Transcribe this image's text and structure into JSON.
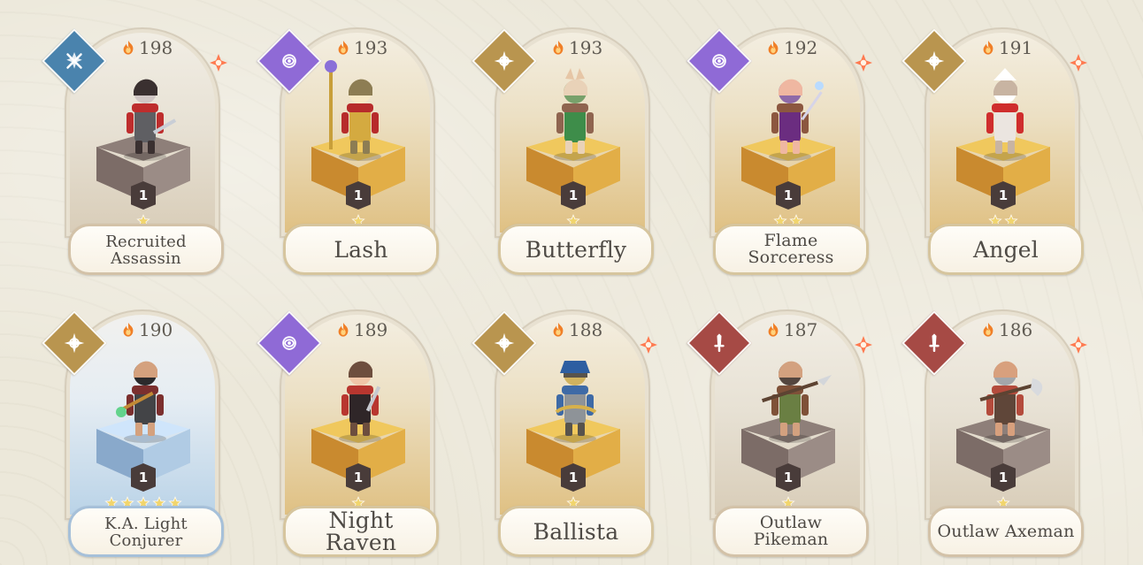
{
  "colors": {
    "background": "#ece8da",
    "text": "#4e4a45",
    "power_text": "#5f5a52",
    "common_banner": "#d3c2a8",
    "rare_banner": "#d6c59e",
    "epic_banner": "#a6c0d9",
    "common_pedestal": "#8e7f79",
    "rare_pedestal": "#f0c85d",
    "epic_pedestal": "#cfe5fb",
    "class_blue": "#4a83ad",
    "class_purple": "#8f6ad6",
    "class_gold": "#b9954f",
    "class_red": "#a64a45",
    "gem": "#ff7a50",
    "star": "#f1d56d",
    "flame": "#f07f27"
  },
  "cards": [
    {
      "name": "Recruited\nAssassin",
      "power": "198",
      "level": "1",
      "stars": 1,
      "tier": "common",
      "class_icon": "sword-cross-icon",
      "class_color": "#4a83ad",
      "has_affinity_gem": true,
      "character_icon": "assassin-sprite-icon"
    },
    {
      "name": "Lash",
      "power": "193",
      "level": "1",
      "stars": 1,
      "tier": "rare",
      "class_icon": "magic-circle-icon",
      "class_color": "#8f6ad6",
      "has_affinity_gem": false,
      "character_icon": "priest-sprite-icon"
    },
    {
      "name": "Butterfly",
      "power": "193",
      "level": "1",
      "stars": 1,
      "tier": "rare",
      "class_icon": "compass-star-icon",
      "class_color": "#b9954f",
      "has_affinity_gem": false,
      "character_icon": "butterfly-sprite-icon"
    },
    {
      "name": "Flame Sorceress",
      "power": "192",
      "level": "1",
      "stars": 2,
      "tier": "rare",
      "class_icon": "magic-circle-icon",
      "class_color": "#8f6ad6",
      "has_affinity_gem": true,
      "character_icon": "sorceress-sprite-icon"
    },
    {
      "name": "Angel",
      "power": "191",
      "level": "1",
      "stars": 2,
      "tier": "rare",
      "class_icon": "compass-star-icon",
      "class_color": "#b9954f",
      "has_affinity_gem": true,
      "character_icon": "angel-sprite-icon"
    },
    {
      "name": "K.A. Light\nConjurer",
      "power": "190",
      "level": "1",
      "stars": 5,
      "tier": "epic",
      "class_icon": "compass-star-icon",
      "class_color": "#b9954f",
      "has_affinity_gem": false,
      "character_icon": "conjurer-sprite-icon"
    },
    {
      "name": "Night Raven",
      "power": "189",
      "level": "1",
      "stars": 1,
      "tier": "rare",
      "class_icon": "magic-circle-icon",
      "class_color": "#8f6ad6",
      "has_affinity_gem": false,
      "character_icon": "raven-sprite-icon"
    },
    {
      "name": "Ballista",
      "power": "188",
      "level": "1",
      "stars": 1,
      "tier": "rare",
      "class_icon": "compass-star-icon",
      "class_color": "#b9954f",
      "has_affinity_gem": true,
      "character_icon": "ballista-sprite-icon"
    },
    {
      "name": "Outlaw Pikeman",
      "power": "187",
      "level": "1",
      "stars": 1,
      "tier": "common",
      "class_icon": "sword-icon",
      "class_color": "#a64a45",
      "has_affinity_gem": true,
      "character_icon": "pikeman-sprite-icon"
    },
    {
      "name": "Outlaw Axeman",
      "power": "186",
      "level": "1",
      "stars": 1,
      "tier": "common",
      "class_icon": "sword-icon",
      "class_color": "#a64a45",
      "has_affinity_gem": true,
      "character_icon": "axeman-sprite-icon"
    }
  ]
}
